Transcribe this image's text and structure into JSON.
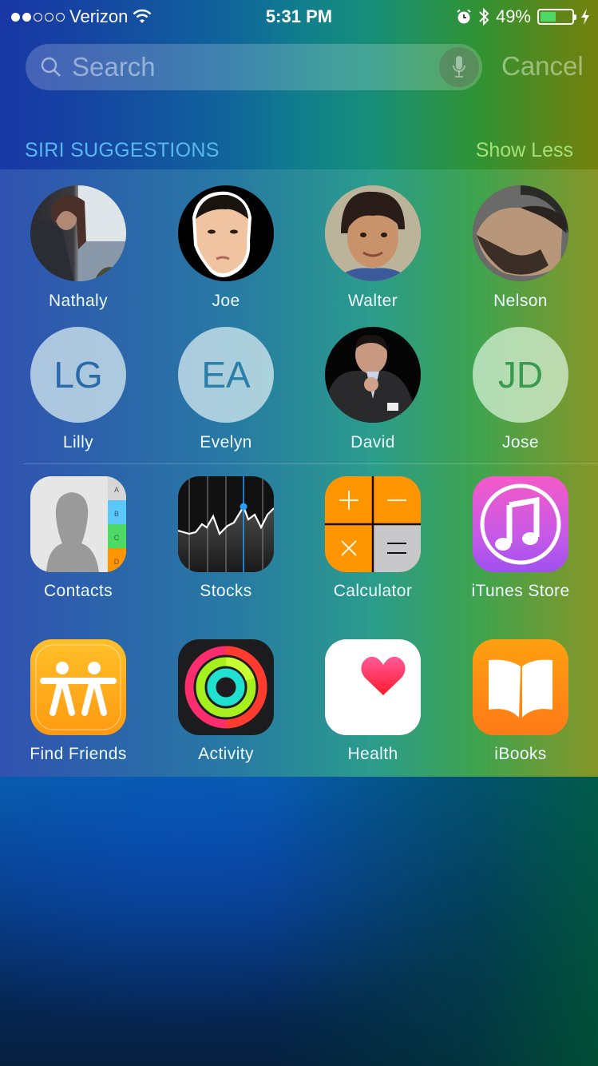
{
  "status_bar": {
    "signal_filled": 2,
    "signal_total": 5,
    "carrier": "Verizon",
    "time": "5:31 PM",
    "battery_percent": "49%",
    "battery_level": 0.49,
    "battery_color": "#4cd964",
    "icons": [
      "wifi-icon",
      "alarm-icon",
      "bluetooth-icon",
      "battery-icon",
      "charging-bolt-icon"
    ]
  },
  "search": {
    "placeholder": "Search",
    "value": "",
    "cancel_label": "Cancel"
  },
  "siri_suggestions": {
    "title": "SIRI SUGGESTIONS",
    "toggle_label": "Show Less",
    "title_color": "#5ab8f0",
    "toggle_color": "#a6e07a",
    "contacts": [
      {
        "name": "Nathaly",
        "type": "photo"
      },
      {
        "name": "Joe",
        "type": "photo"
      },
      {
        "name": "Walter",
        "type": "photo"
      },
      {
        "name": "Nelson",
        "type": "photo"
      },
      {
        "name": "Lilly",
        "type": "initials",
        "initials": "LG",
        "initials_color": "#2a6aa8"
      },
      {
        "name": "Evelyn",
        "type": "initials",
        "initials": "EA",
        "initials_color": "#2a7ea8"
      },
      {
        "name": "David",
        "type": "photo"
      },
      {
        "name": "Jose",
        "type": "initials",
        "initials": "JD",
        "initials_color": "#3a9a50"
      }
    ],
    "apps": [
      {
        "name": "Contacts",
        "icon": "contacts-icon",
        "tabs": [
          "A",
          "B",
          "C",
          "D"
        ]
      },
      {
        "name": "Stocks",
        "icon": "stocks-icon"
      },
      {
        "name": "Calculator",
        "icon": "calculator-icon"
      },
      {
        "name": "iTunes Store",
        "icon": "itunes-store-icon"
      },
      {
        "name": "Find Friends",
        "icon": "find-friends-icon"
      },
      {
        "name": "Activity",
        "icon": "activity-icon"
      },
      {
        "name": "Health",
        "icon": "health-icon"
      },
      {
        "name": "iBooks",
        "icon": "ibooks-icon"
      }
    ]
  }
}
